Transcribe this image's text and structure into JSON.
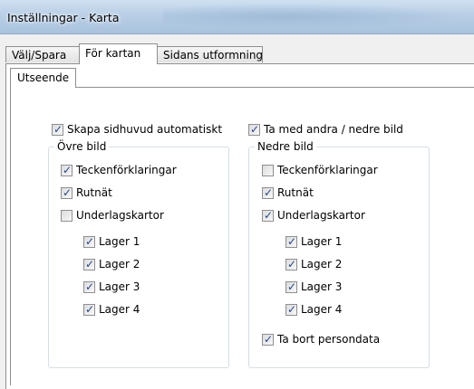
{
  "window": {
    "title": "Inställningar - Karta"
  },
  "tabs": [
    {
      "label": "Välj/Spara",
      "active": false
    },
    {
      "label": "För kartan",
      "active": true
    },
    {
      "label": "Sidans utformning",
      "active": false
    }
  ],
  "subtab": {
    "label": "Utseende"
  },
  "options": {
    "auto_header": {
      "label": "Skapa sidhuvud automatiskt",
      "checked": true
    },
    "include_second": {
      "label": "Ta med andra / nedre bild",
      "checked": true
    }
  },
  "upper": {
    "title": "Övre bild",
    "legends": {
      "label": "Teckenförklaringar",
      "checked": true
    },
    "grid": {
      "label": "Rutnät",
      "checked": true
    },
    "basemaps": {
      "label": "Underlagskartor",
      "checked": false
    },
    "layers": [
      {
        "label": "Lager 1",
        "checked": true
      },
      {
        "label": "Lager 2",
        "checked": true
      },
      {
        "label": "Lager 3",
        "checked": true
      },
      {
        "label": "Lager 4",
        "checked": true
      }
    ]
  },
  "lower": {
    "title": "Nedre bild",
    "legends": {
      "label": "Teckenförklaringar",
      "checked": false
    },
    "grid": {
      "label": "Rutnät",
      "checked": true
    },
    "basemaps": {
      "label": "Underlagskartor",
      "checked": true
    },
    "layers": [
      {
        "label": "Lager 1",
        "checked": true
      },
      {
        "label": "Lager 2",
        "checked": true
      },
      {
        "label": "Lager 3",
        "checked": true
      },
      {
        "label": "Lager 4",
        "checked": true
      }
    ],
    "remove_personal": {
      "label": "Ta bort persondata",
      "checked": true
    }
  }
}
